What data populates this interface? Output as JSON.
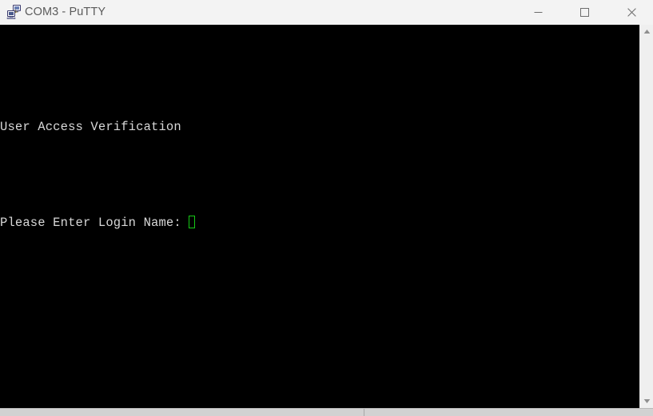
{
  "window": {
    "title": "COM3 - PuTTY",
    "icon": "putty-terminal-icon",
    "colors": {
      "titlebar_bg": "#f3f3f3",
      "title_fg": "#5b5b5b",
      "terminal_bg": "#000000",
      "terminal_fg": "#d8d8d8",
      "cursor": "#16c916",
      "scrollbar_bg": "#efefef",
      "bottom_strip": "#d2d2d2"
    },
    "controls": {
      "minimize": "—",
      "maximize": "☐",
      "close": "✕",
      "minimize_label": "Minimize",
      "maximize_label": "Maximize",
      "close_label": "Close"
    }
  },
  "terminal": {
    "lines": [
      "User Access Verification",
      "",
      "Please Enter Login Name: "
    ],
    "line1": "User Access Verification",
    "line2": "Please Enter Login Name: ",
    "cursor_visible": true,
    "cursor_style": "hollow-block",
    "prompt_input_value": ""
  },
  "scrollbar": {
    "up_arrow": "▲",
    "down_arrow": "▼",
    "thumb_visible": false
  }
}
